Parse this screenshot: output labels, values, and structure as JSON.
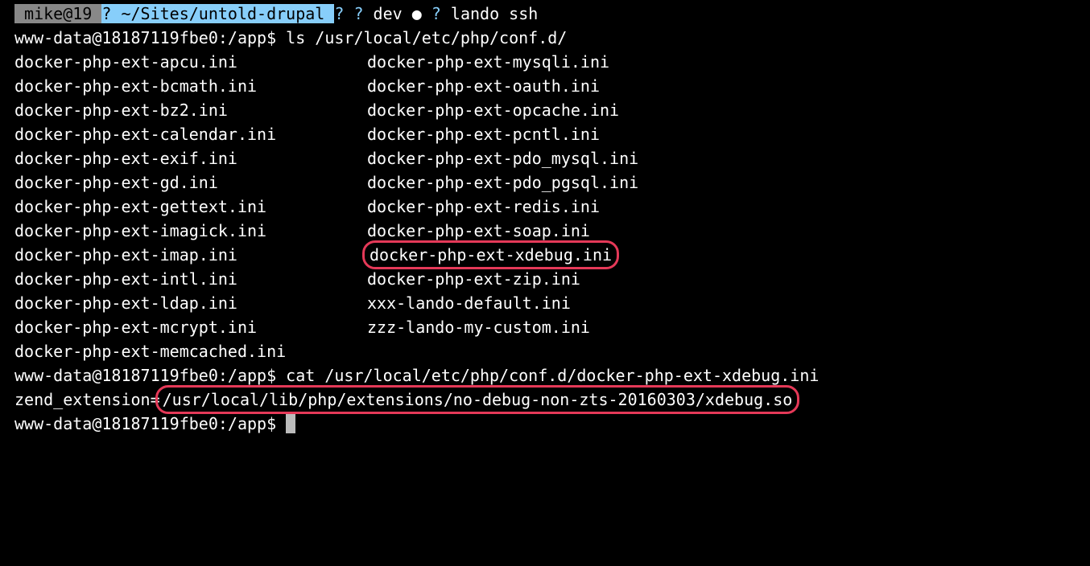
{
  "statusbar": {
    "user": " mike@19 ",
    "path_icon": "?",
    "path": " ~/Sites/untold-drupal ",
    "git_icon1": "?",
    "git_icon2": "?",
    "branch": " dev ",
    "dot": "●",
    "state_icon": "?",
    "trailing_cmd": " lando ssh"
  },
  "prompt1": {
    "ps1": "www-data@18187119fbe0:/app$ ",
    "cmd": "ls /usr/local/etc/php/conf.d/"
  },
  "listing": {
    "col1": [
      "docker-php-ext-apcu.ini",
      "docker-php-ext-bcmath.ini",
      "docker-php-ext-bz2.ini",
      "docker-php-ext-calendar.ini",
      "docker-php-ext-exif.ini",
      "docker-php-ext-gd.ini",
      "docker-php-ext-gettext.ini",
      "docker-php-ext-imagick.ini",
      "docker-php-ext-imap.ini",
      "docker-php-ext-intl.ini",
      "docker-php-ext-ldap.ini",
      "docker-php-ext-mcrypt.ini",
      "docker-php-ext-memcached.ini"
    ],
    "col2": [
      "docker-php-ext-mysqli.ini",
      "docker-php-ext-oauth.ini",
      "docker-php-ext-opcache.ini",
      "docker-php-ext-pcntl.ini",
      "docker-php-ext-pdo_mysql.ini",
      "docker-php-ext-pdo_pgsql.ini",
      "docker-php-ext-redis.ini",
      "docker-php-ext-soap.ini",
      "docker-php-ext-xdebug.ini",
      "docker-php-ext-zip.ini",
      "xxx-lando-default.ini",
      "zzz-lando-my-custom.ini"
    ],
    "highlight_col2_index": 8
  },
  "prompt2": {
    "ps1": "www-data@18187119fbe0:/app$ ",
    "cmd": "cat /usr/local/etc/php/conf.d/docker-php-ext-xdebug.ini"
  },
  "ext_output": {
    "prefix": "zend_extension=",
    "path": "/usr/local/lib/php/extensions/no-debug-non-zts-20160303/xdebug.so"
  },
  "prompt3": {
    "ps1": "www-data@18187119fbe0:/app$ "
  }
}
